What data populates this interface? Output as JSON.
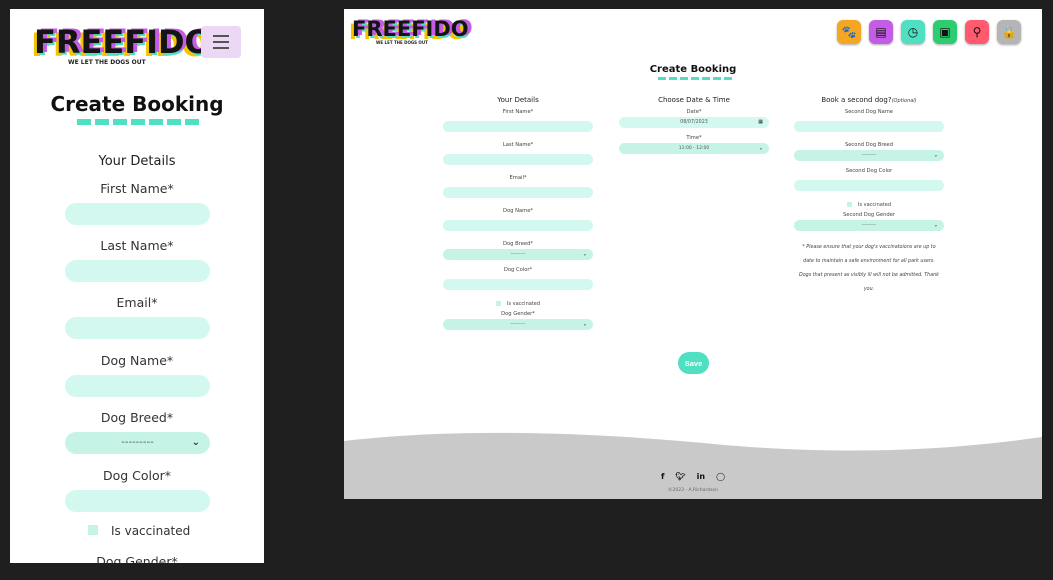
{
  "brand": {
    "name": "FREEFIDO",
    "tagline": "WE LET THE DOGS OUT",
    "accent": "#4fe0c2",
    "purple": "#c45ce6",
    "yellow": "#f5c400"
  },
  "page_title": "Create Booking",
  "mobile": {
    "section_title": "Your Details",
    "labels": {
      "first_name": "First Name*",
      "last_name": "Last Name*",
      "email": "Email*",
      "dog_name": "Dog Name*",
      "dog_breed": "Dog Breed*",
      "dog_color": "Dog Color*",
      "is_vaccinated": "Is vaccinated",
      "dog_gender": "Dog Gender*"
    },
    "dog_breed_value": "---------"
  },
  "nav_icons": [
    {
      "name": "paw-icon",
      "glyph": "🐾",
      "color": "#f5a623"
    },
    {
      "name": "book-icon",
      "glyph": "▤",
      "color": "#c45ce6"
    },
    {
      "name": "calendar-clock-icon",
      "glyph": "◷",
      "color": "#4fe0c2"
    },
    {
      "name": "wallet-icon",
      "glyph": "▣",
      "color": "#2ecc71"
    },
    {
      "name": "location-pin-icon",
      "glyph": "⚲",
      "color": "#ff5a6e"
    },
    {
      "name": "lock-icon",
      "glyph": "🔒",
      "color": "#b5b5b5"
    }
  ],
  "desktop": {
    "col1": {
      "heading": "Your Details",
      "first_name": "First Name*",
      "last_name": "Last Name*",
      "email": "Email*",
      "dog_name": "Dog Name*",
      "dog_breed": "Dog Breed*",
      "dog_breed_value": "---------",
      "dog_color": "Dog Color*",
      "is_vaccinated": "Is vaccinated",
      "dog_gender": "Dog Gender*",
      "dog_gender_value": "---------"
    },
    "col2": {
      "heading": "Choose Date & Time",
      "date_label": "Date*",
      "date_value": "08/07/2023",
      "time_label": "Time*",
      "time_value": "11:00 - 12:00"
    },
    "col3": {
      "heading": "Book a second dog?",
      "heading_optional": "(Optional)",
      "second_dog_name": "Second Dog Name",
      "second_dog_breed": "Second Dog Breed",
      "second_dog_breed_value": "---------",
      "second_dog_color": "Second Dog Color",
      "is_vaccinated": "Is vaccinated",
      "second_dog_gender": "Second Dog Gender",
      "second_dog_gender_value": "---------",
      "note": "* Please ensure that your dog's vaccinatoions are up to date to maintain a safe environment for all park users. Dogs that present as visibly ill will not be admitted. Thank you."
    },
    "save_label": "Save",
    "social": [
      "f",
      "t",
      "in",
      "gh"
    ],
    "copyright": "©2023 - A.Richardson"
  }
}
